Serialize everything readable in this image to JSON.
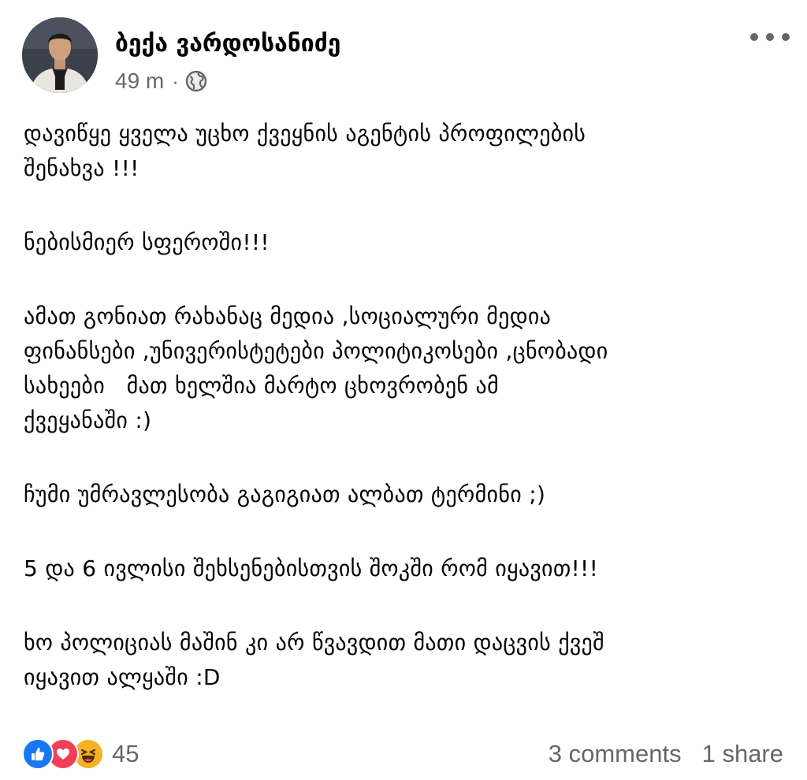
{
  "post": {
    "author": "ბექა ვარდოსანიძე",
    "time": "49 m",
    "separator": "·",
    "audience_icon": "globe-icon",
    "more_icon": "more-options-icon",
    "paragraphs": [
      [
        "დავიწყე ყველა უცხო ქვეყნის აგენტის პროფილების",
        "შენახვა !!!"
      ],
      [
        "ნებისმიერ სფეროში!!!"
      ],
      [
        "ამათ გონიათ რახანაც მედია ,სოციალური მედია",
        "ფინანსები ,უნივერისტეტები პოლიტიკოსები ,ცნობადი",
        "სახეები   მათ ხელშია მარტო ცხოვრობენ ამ",
        "ქვეყანაში :)"
      ],
      [
        "ჩუმი უმრავლესობა გაგიგიათ ალბათ ტერმინი ;)"
      ],
      [
        "5 და 6 ივლისი შეხსენებისთვის შოკში რომ იყავით!!!"
      ],
      [
        "ხო პოლიციას მაშინ კი არ წვავდით მათი დაცვის ქვეშ",
        "იყავით ალყაში :D"
      ]
    ],
    "reactions": {
      "icons": [
        "like-icon",
        "love-icon",
        "haha-icon"
      ],
      "count": "45"
    },
    "comments": "3 comments",
    "shares": "1 share"
  },
  "colors": {
    "like": "#1877f2",
    "love": "#f33e58",
    "haha": "#f7b125",
    "secondary_text": "#65676b"
  }
}
